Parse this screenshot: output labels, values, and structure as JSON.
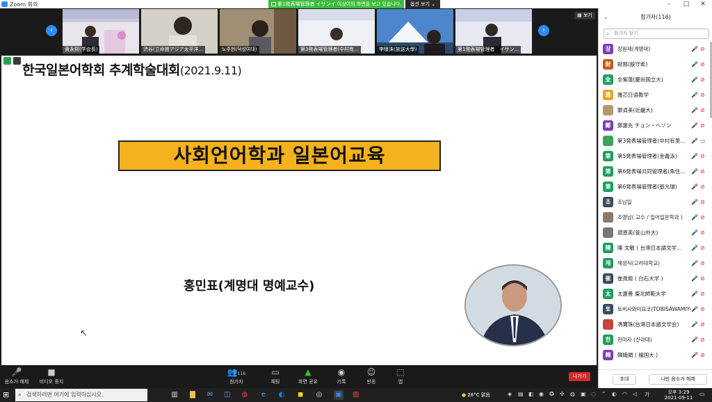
{
  "window": {
    "title": "Zoom 회의",
    "minimize": "–",
    "maximize": "□",
    "close": "✕"
  },
  "sharebar": {
    "text": "第1発表場管理者 イサンイ 이상이의 화면을 보고 있습니다.",
    "options": "옵션 보기 ⌄"
  },
  "strip": {
    "view_label": "▦ 보기",
    "prev": "‹",
    "next": "›",
    "thumbs": [
      {
        "name": "黄永熙(学会長)"
      },
      {
        "name": "渋谷(立命館アジア太平洋..."
      },
      {
        "name": "노주현(덕성여대)"
      },
      {
        "name": "第3発表場管理者(中村有..."
      },
      {
        "name": "李暻洙(放送大學)"
      },
      {
        "name": "第1発表場管理者　イサン..."
      }
    ]
  },
  "slide": {
    "header_main": "한국일본어학회 추계학술대회",
    "header_year": "(2021.9.11)",
    "title": "사회언어학과 일본어교육",
    "speaker": "홍민표(계명대 명예교수)"
  },
  "toolbar": {
    "audio": "음소거 해제",
    "video": "비디오 중지",
    "participants": "참가자",
    "participant_count": "116",
    "chat": "채팅",
    "share": "화면 공유",
    "record": "기록",
    "reactions": "반응",
    "apps": "앱",
    "leave": "나가기"
  },
  "panel": {
    "title": "참가자(116)",
    "search_placeholder": "참가자 찾기",
    "mute_me": "나만 음소거 해제",
    "invite": "초대",
    "participants": [
      {
        "initial": "장",
        "color": "#7b3fb5",
        "name": "장원재(계명대)",
        "cam": "off"
      },
      {
        "initial": "財",
        "color": "#c45a1c",
        "name": "財務(殷守希)",
        "cam": "off"
      },
      {
        "initial": "全",
        "color": "#1e9e62",
        "name": "全紫蓮(慶尚国立大)",
        "cam": "off"
      },
      {
        "initial": "雅",
        "color": "#e8a51a",
        "name": "雅芯日语教学",
        "cam": "off"
      },
      {
        "initial": "",
        "color": "#b49a6a",
        "name": "鄭貞美(近畿大)",
        "cam": "off"
      },
      {
        "initial": "鄭",
        "color": "#7b3fb5",
        "name": "鄭惠先 チョン・ヘソン",
        "cam": "off"
      },
      {
        "initial": "",
        "color": "#3aa55a",
        "name": "第3発表場管理者(中村有里...",
        "cam": "on"
      },
      {
        "initial": "第",
        "color": "#1e9e62",
        "name": "第5発表場管理者(金義泳)",
        "cam": "off"
      },
      {
        "initial": "第",
        "color": "#1e9e62",
        "name": "第6発表場共同管理者(魚住...",
        "cam": "off"
      },
      {
        "initial": "第",
        "color": "#1e9e62",
        "name": "第6発表場管理者(張允瑞)",
        "cam": "off"
      },
      {
        "initial": "조",
        "color": "#3d4a5a",
        "name": "조남일",
        "cam": "off"
      },
      {
        "initial": "",
        "color": "#8d7a68",
        "name": "조영남( 교수 / 일어일문학과 )",
        "cam": "off"
      },
      {
        "initial": "",
        "color": "#777777",
        "name": "趙恩英(釜山外大)",
        "cam": "off"
      },
      {
        "initial": "陳",
        "color": "#1e9e62",
        "name": "陳 文敏 ( 台灣日本語文学...",
        "cam": "off"
      },
      {
        "initial": "채",
        "color": "#1e9e62",
        "name": "채성식(고려대학교)",
        "cam": "off"
      },
      {
        "initial": "崔",
        "color": "#3d4a5a",
        "name": "崔眞姫 ( 白石大学 )",
        "cam": "off"
      },
      {
        "initial": "太",
        "color": "#1e9e62",
        "name": "太惠善 東北師範大学",
        "cam": "off"
      },
      {
        "initial": "토",
        "color": "#3d4a5a",
        "name": "토비사와미요코(TOBISAWAMIYO...",
        "cam": "off"
      },
      {
        "initial": "",
        "color": "#c6453e",
        "name": "馮寶珠(台灣日本語文学会)",
        "cam": "off"
      },
      {
        "initial": "한",
        "color": "#1e9e62",
        "name": "한미자 (신라대)",
        "cam": "off"
      },
      {
        "initial": "韓",
        "color": "#7b3fb5",
        "name": "韓娥娟 ( 檀国大 )",
        "cam": "off"
      }
    ]
  },
  "taskbar": {
    "search_placeholder": "검색하려면 여기에 입력하십시오.",
    "weather": "28°C 맑음",
    "ime": "가",
    "time": "오후 3:29",
    "date": "2021-09-11"
  }
}
